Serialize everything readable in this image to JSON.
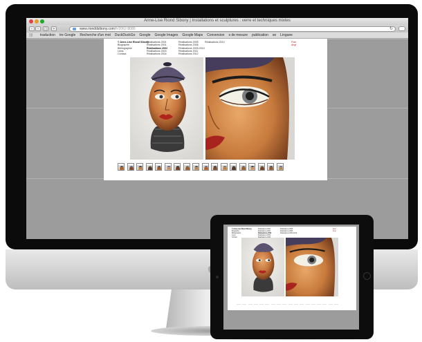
{
  "window": {
    "title": "Anne-Lise Riond Sibony | Installations et sculptures : verre et techniques mixtes"
  },
  "address_bar": {
    "url": "www.rionddsibony.com",
    "url_tail": "/fr/2062-8080"
  },
  "bookmarks": [
    "traduction",
    "tre Google",
    "Recherche d'un mot",
    "DuckDuckGo",
    "Google",
    "Google Images",
    "Google Maps",
    "Conversion",
    "s de mesure",
    "publication",
    "se",
    "Linguee"
  ],
  "site": {
    "menu_col1": [
      "© Anne-Lise Riond Sibony",
      "Biographie",
      "Bibliographie",
      "Liens",
      "Contact"
    ],
    "menu_col2": [
      "Réalisations 2001",
      "Réalisations 2001",
      "Réalisations 2002",
      "Réalisations 2003",
      "Réalisations 2004"
    ],
    "menu_col3": [
      "Réalisations 2005",
      "Réalisations 2006",
      "Réalisations 2009-2010",
      "Réalisations 2011",
      "Réalisations 2012"
    ],
    "menu_col4": [
      "Réalisations 2013"
    ],
    "active_item": "Réalisations 2002",
    "languages": [
      "Fran",
      "Angl"
    ]
  },
  "thumbnails_count": 18,
  "colors": {
    "desktop_bg": "#9c9c9c",
    "page_bg": "#ffffff",
    "accent_red": "#c0272d",
    "bezel": "#0b0b0b"
  },
  "icons": [
    "close-icon",
    "minimize-icon",
    "zoom-icon",
    "back-icon",
    "forward-icon",
    "plus-icon",
    "reload-icon",
    "apple-logo-icon",
    "home-button-icon",
    "camera-icon"
  ]
}
